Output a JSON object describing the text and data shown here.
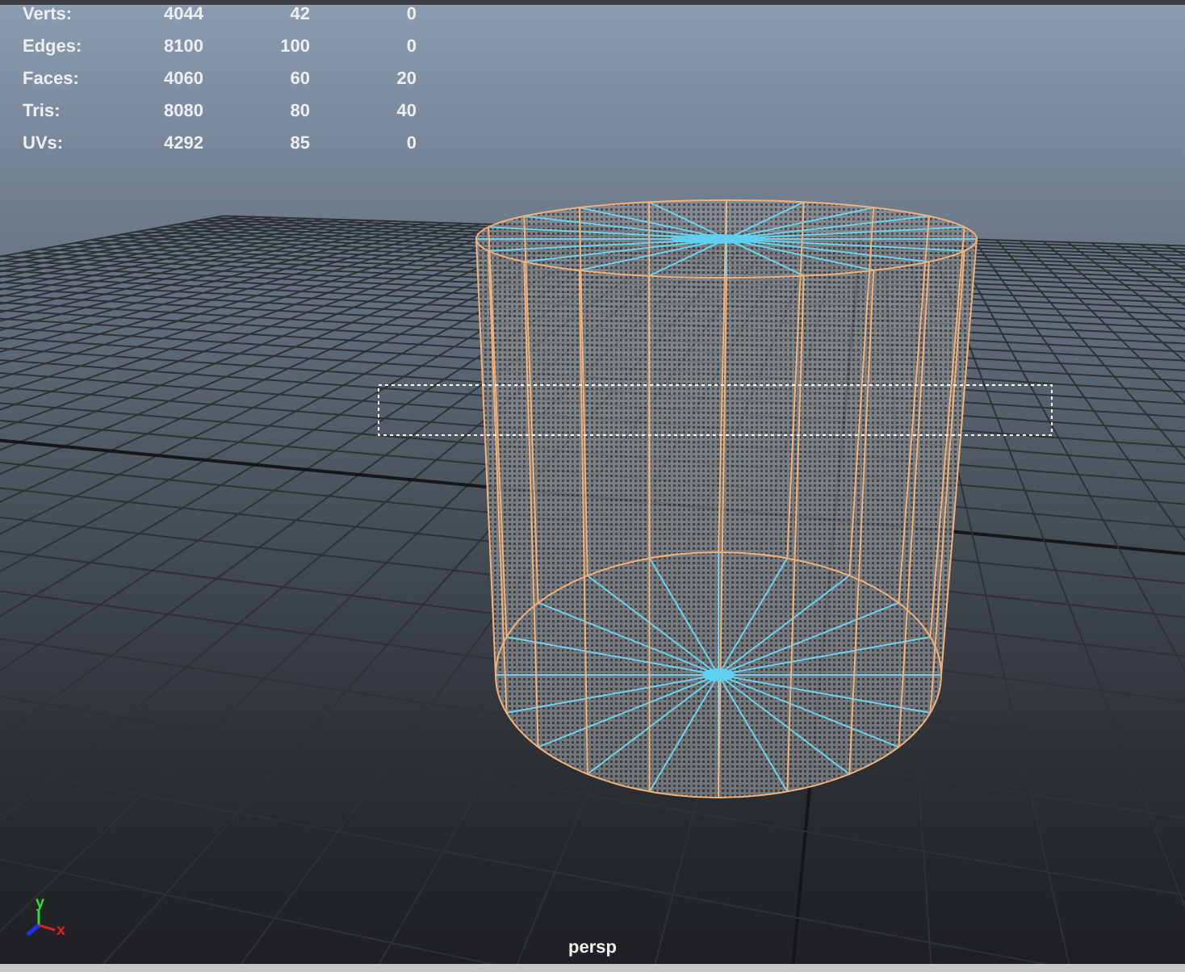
{
  "hud_stats": [
    {
      "label": "Verts:",
      "values": [
        "4044",
        "42",
        "0"
      ]
    },
    {
      "label": "Edges:",
      "values": [
        "8100",
        "100",
        "0"
      ]
    },
    {
      "label": "Faces:",
      "values": [
        "4060",
        "60",
        "20"
      ]
    },
    {
      "label": "Tris:",
      "values": [
        "8080",
        "80",
        "40"
      ]
    },
    {
      "label": "UVs:",
      "values": [
        "4292",
        "85",
        "0"
      ]
    }
  ],
  "axis_gizmo": {
    "x_label": "x",
    "y_label": "y"
  },
  "camera_label": "persp"
}
